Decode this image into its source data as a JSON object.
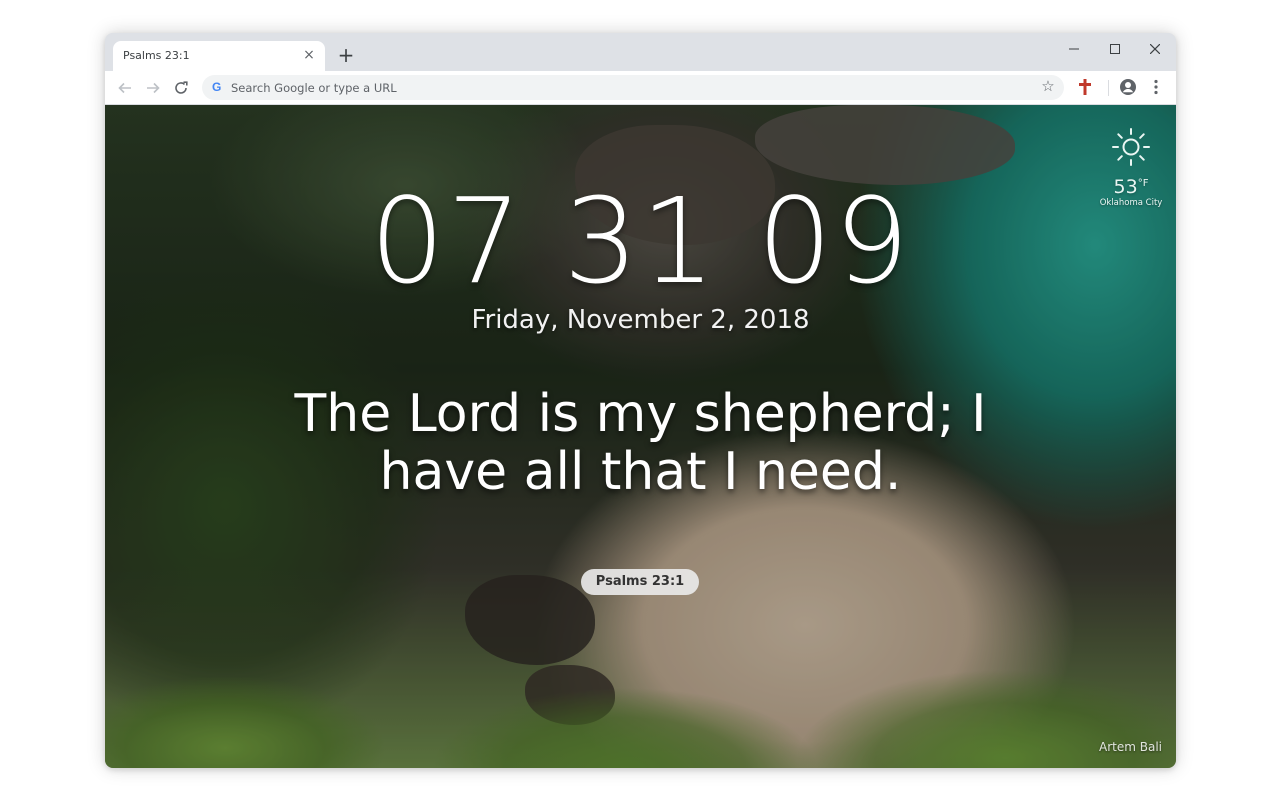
{
  "browser": {
    "tab": {
      "title": "Psalms 23:1",
      "close_glyph": "×"
    },
    "new_tab_glyph": "+",
    "window_controls": {
      "minimize": "minimize-icon",
      "maximize": "maximize-icon",
      "close": "close-icon"
    },
    "omnibox": {
      "placeholder": "Search Google or type a URL",
      "logo": "G"
    },
    "icons": [
      "back-icon",
      "forward-icon",
      "reload-icon",
      "star-icon",
      "cross-extension-icon",
      "profile-icon",
      "menu-icon"
    ]
  },
  "page": {
    "clock": "07 31 09",
    "date": "Friday, November 2, 2018",
    "verse": "The Lord is my shepherd; I have all that I need.",
    "reference": "Psalms 23:1",
    "weather": {
      "icon": "sun-icon",
      "temperature": "53",
      "unit": "°F",
      "city": "Oklahoma City"
    },
    "photo_credit": "Artem Bali"
  },
  "colors": {
    "tabstrip": "#dee1e6",
    "omnibox": "#f1f3f4",
    "extension_cross": "#c0392b"
  }
}
